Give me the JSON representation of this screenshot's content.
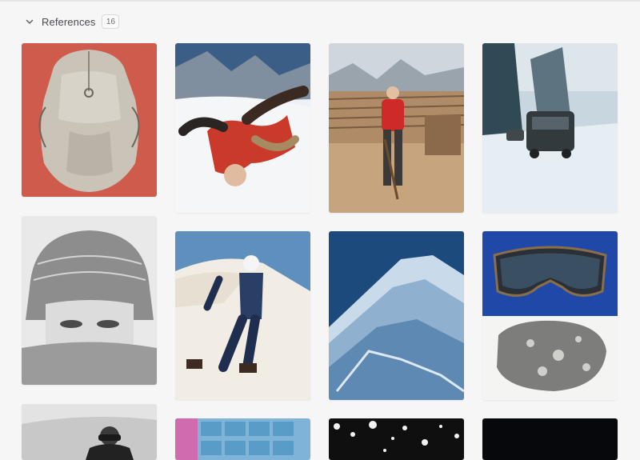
{
  "section": {
    "title": "References",
    "count": "16",
    "collapse_icon": "chevron-down-icon"
  },
  "images": [
    {
      "name": "backpack-image",
      "subject": "backpack"
    },
    {
      "name": "skier-tumbling-image",
      "subject": "skier"
    },
    {
      "name": "lumber-worker-image",
      "subject": "worker"
    },
    {
      "name": "snowy-street-car-image",
      "subject": "car"
    },
    {
      "name": "knit-hat-face-image",
      "subject": "portrait"
    },
    {
      "name": "retro-skier-walking-image",
      "subject": "skier"
    },
    {
      "name": "snow-mountain-ridge-image",
      "subject": "mountain"
    },
    {
      "name": "goggles-and-rock-image",
      "subject": "goggles"
    },
    {
      "name": "bw-skier-portrait-image",
      "subject": "skier"
    },
    {
      "name": "blue-film-strip-image",
      "subject": "filmstrip"
    },
    {
      "name": "snow-night-sky-image",
      "subject": "snow"
    },
    {
      "name": "dark-night-image",
      "subject": "dark"
    }
  ],
  "colors": {
    "background": "#f6f6f7",
    "badge_border": "#d9d9dc",
    "text": "#4a4a4d"
  }
}
